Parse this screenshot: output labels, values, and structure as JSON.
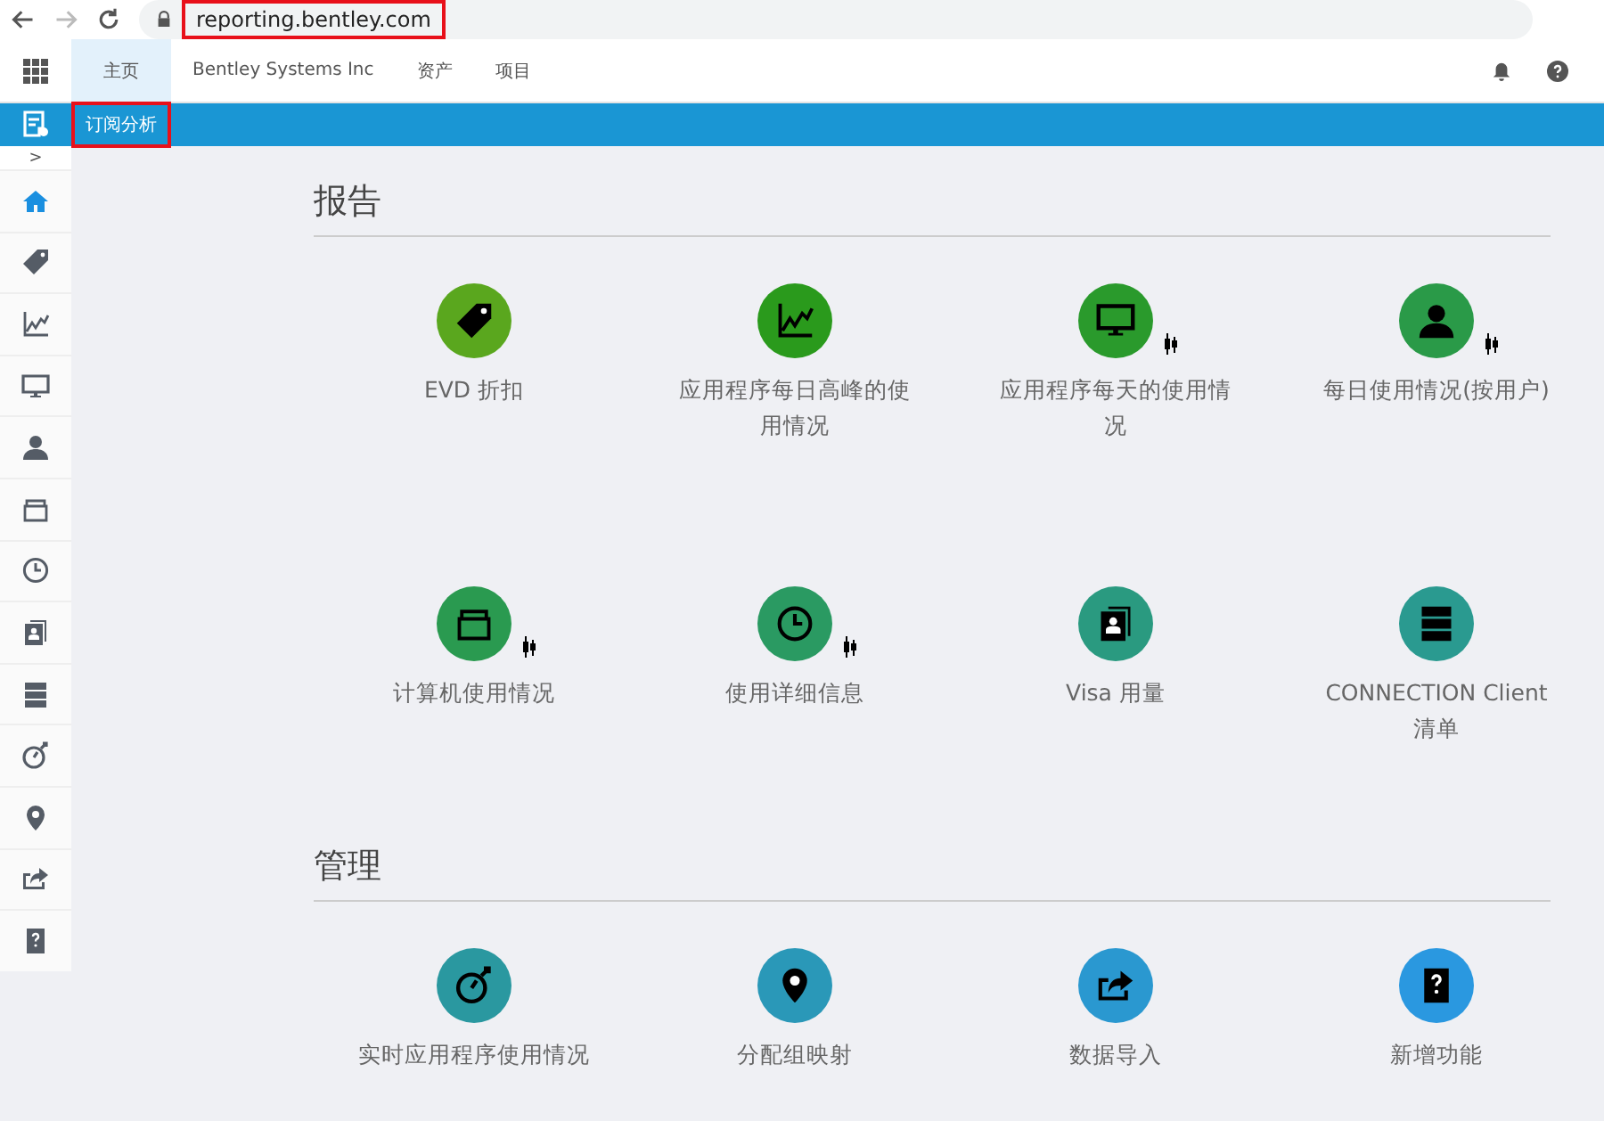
{
  "browser": {
    "url": "reporting.bentley.com",
    "url_highlighted": true
  },
  "top_nav": {
    "tabs": [
      {
        "label": "主页",
        "selected": true
      },
      {
        "label": "Bentley Systems Inc",
        "selected": false
      },
      {
        "label": "资产",
        "selected": false
      },
      {
        "label": "项目",
        "selected": false
      }
    ]
  },
  "sub_bar": {
    "label": "订阅分析",
    "highlighted": true
  },
  "sidebar": {
    "expand": ">",
    "items": [
      {
        "selected": true
      },
      {
        "selected": false
      },
      {
        "selected": false
      },
      {
        "selected": false
      },
      {
        "selected": false
      },
      {
        "selected": false
      },
      {
        "selected": false
      },
      {
        "selected": false
      },
      {
        "selected": false
      },
      {
        "selected": false
      },
      {
        "selected": false
      },
      {
        "selected": false
      },
      {
        "selected": false
      }
    ]
  },
  "sections": [
    {
      "title": "报告",
      "tiles": [
        {
          "label": "EVD 折扣",
          "color": "#5aa71e",
          "badge": false
        },
        {
          "label": "应用程序每日高峰的使用情况",
          "color": "#2a9a1c",
          "badge": false
        },
        {
          "label": "应用程序每天的使用情况",
          "color": "#2a9a2c",
          "badge": true
        },
        {
          "label": "每日使用情况(按用户)",
          "color": "#2a9a48",
          "badge": true
        },
        {
          "label": "计算机使用情况",
          "color": "#2a9a50",
          "badge": true
        },
        {
          "label": "使用详细信息",
          "color": "#2a9a62",
          "badge": true
        },
        {
          "label": "Visa 用量",
          "color": "#2a9a80",
          "badge": false
        },
        {
          "label": "CONNECTION Client 清单",
          "color": "#2a9a90",
          "badge": false
        }
      ]
    },
    {
      "title": "管理",
      "tiles": [
        {
          "label": "实时应用程序使用情况",
          "color": "#2a98a0",
          "badge": false
        },
        {
          "label": "分配组映射",
          "color": "#2a98b8",
          "badge": false
        },
        {
          "label": "数据导入",
          "color": "#2a98d0",
          "badge": false
        },
        {
          "label": "新增功能",
          "color": "#2a98e0",
          "badge": false
        }
      ]
    }
  ]
}
